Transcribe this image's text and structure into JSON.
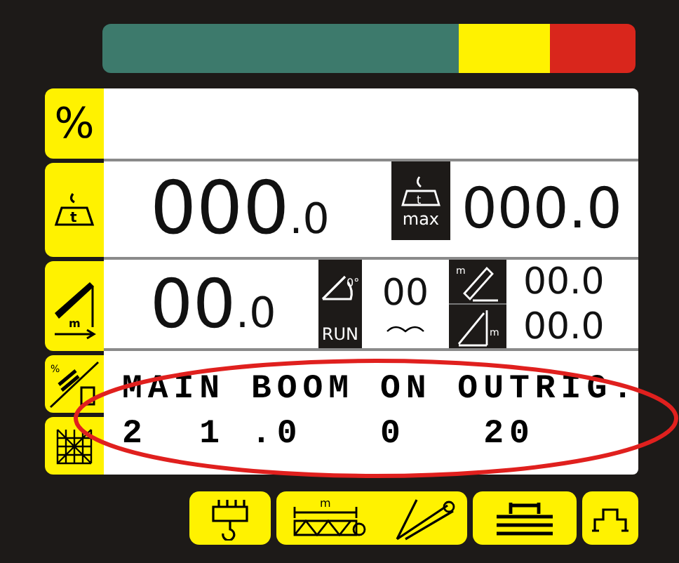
{
  "load_zone_bar": {
    "shown": true
  },
  "side_buttons": [
    {
      "kind": "percent",
      "label": "%"
    },
    {
      "kind": "load",
      "label": "t"
    },
    {
      "kind": "radius",
      "label": "m"
    },
    {
      "kind": "config",
      "label": "%"
    },
    {
      "kind": "grid"
    }
  ],
  "load": {
    "whole": "000",
    "fraction": ".0"
  },
  "max_load": {
    "label": "t",
    "tag": "max",
    "value": "000.0"
  },
  "radius": {
    "whole": "00",
    "fraction": ".0"
  },
  "angle": {
    "degree": "0°",
    "tag": "RUN",
    "value": "00"
  },
  "boom_length": {
    "label": "m",
    "value": "00.0"
  },
  "boom_height": {
    "label": "m",
    "value": "00.0"
  },
  "message": {
    "title": "MAIN BOOM ON OUTRIG.",
    "values": "2  1 .0   0   20"
  },
  "bottom_buttons": [
    {
      "kind": "hook"
    },
    {
      "kind": "boom",
      "label": "m"
    },
    {
      "kind": "outriggers"
    },
    {
      "kind": "base"
    }
  ],
  "highlight_ring": {
    "shown": true
  }
}
